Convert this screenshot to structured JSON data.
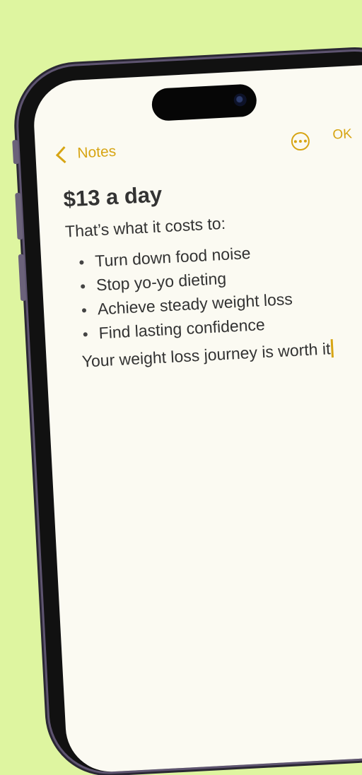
{
  "nav": {
    "back_label": "Notes",
    "more_icon": "ellipsis-circle-icon",
    "done_label": "OK"
  },
  "note": {
    "title": "$13 a day",
    "intro": "That’s what it costs to:",
    "bullets": [
      "Turn down food noise",
      "Stop yo-yo dieting",
      "Achieve steady weight loss",
      "Find lasting confidence"
    ],
    "closing": "Your weight loss journey is worth it"
  },
  "colors": {
    "background": "#def5a0",
    "accent": "#d7a514",
    "screen": "#fbfaf2",
    "text": "#333333"
  }
}
